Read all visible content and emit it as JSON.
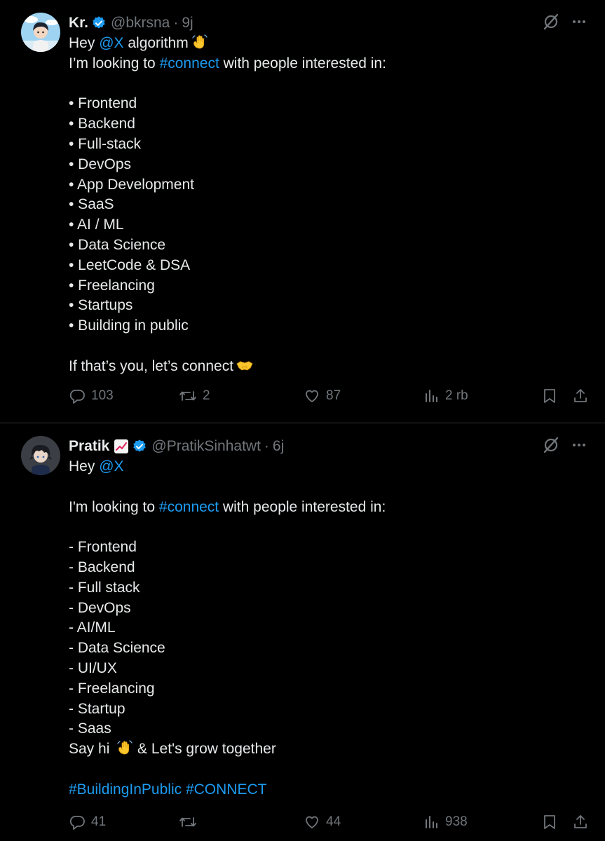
{
  "tweets": [
    {
      "name": "Kr.",
      "handle": "@bkrsna",
      "separator": "·",
      "time": "9j",
      "lines": [
        [
          {
            "t": "Hey "
          },
          {
            "t": "@X",
            "link": true
          },
          {
            "t": " algorithm"
          },
          {
            "emoji": "waving-hand"
          }
        ],
        [
          {
            "t": "I’m looking to "
          },
          {
            "t": "#connect",
            "link": true
          },
          {
            "t": " with people interested in:"
          }
        ],
        [],
        [
          {
            "t": "• Frontend"
          }
        ],
        [
          {
            "t": "• Backend"
          }
        ],
        [
          {
            "t": "• Full-stack"
          }
        ],
        [
          {
            "t": "• DevOps"
          }
        ],
        [
          {
            "t": "• App Development"
          }
        ],
        [
          {
            "t": "• SaaS"
          }
        ],
        [
          {
            "t": "• AI / ML"
          }
        ],
        [
          {
            "t": "• Data Science"
          }
        ],
        [
          {
            "t": "• LeetCode & DSA"
          }
        ],
        [
          {
            "t": "• Freelancing"
          }
        ],
        [
          {
            "t": "• Startups"
          }
        ],
        [
          {
            "t": "• Building in public"
          }
        ],
        [],
        [
          {
            "t": "If that’s you, let’s connect"
          },
          {
            "emoji": "handshake"
          }
        ]
      ],
      "stats": {
        "replies": "103",
        "reposts": "2",
        "likes": "87",
        "views": "2 rb"
      }
    },
    {
      "name": "Pratik",
      "name_emoji": "chart-increasing",
      "handle": "@PratikSinhatwt",
      "separator": "·",
      "time": "6j",
      "lines": [
        [
          {
            "t": "Hey "
          },
          {
            "t": "@X",
            "link": true
          }
        ],
        [],
        [
          {
            "t": "I'm looking to "
          },
          {
            "t": "#connect",
            "link": true
          },
          {
            "t": " with people interested in:"
          }
        ],
        [],
        [
          {
            "t": "- Frontend"
          }
        ],
        [
          {
            "t": "- Backend"
          }
        ],
        [
          {
            "t": "- Full stack"
          }
        ],
        [
          {
            "t": "- DevOps"
          }
        ],
        [
          {
            "t": "- AI/ML"
          }
        ],
        [
          {
            "t": "- Data Science"
          }
        ],
        [
          {
            "t": "- UI/UX"
          }
        ],
        [
          {
            "t": "- Freelancing"
          }
        ],
        [
          {
            "t": "- Startup"
          }
        ],
        [
          {
            "t": "- Saas"
          }
        ],
        [
          {
            "t": "Say hi "
          },
          {
            "emoji": "waving-hand"
          },
          {
            "t": " & Let's grow together"
          }
        ],
        [],
        [
          {
            "t": " "
          },
          {
            "t": "#BuildingInPublic",
            "link": true
          },
          {
            "t": " "
          },
          {
            "t": "#CONNECT",
            "link": true
          }
        ]
      ],
      "stats": {
        "replies": "41",
        "reposts": "",
        "likes": "44",
        "views": "938"
      }
    }
  ],
  "colors": {
    "background": "#000000",
    "text": "#e7e9ea",
    "muted": "#71767b",
    "link": "#1d9bf0",
    "divider": "#2f3336",
    "verified": "#1d9bf0"
  }
}
